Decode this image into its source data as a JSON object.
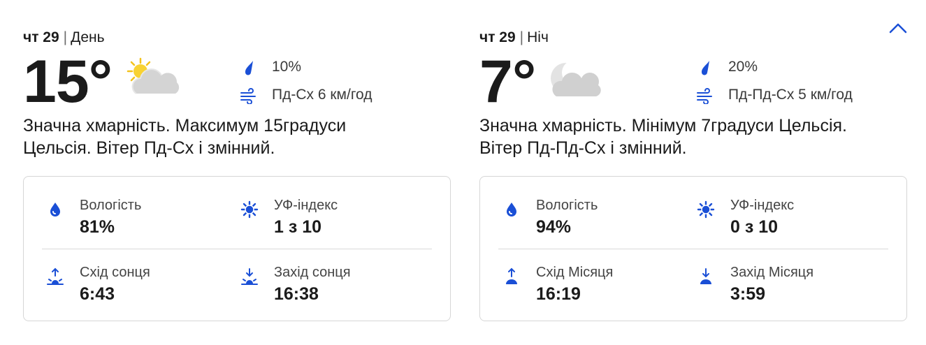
{
  "day": {
    "date": "чт 29",
    "period": "День",
    "temperature": "15°",
    "condition_icon": "sun-behind-cloud-icon",
    "precipitation": "10%",
    "wind": "Пд-Сх 6 км/год",
    "description": "Значна хмарність. Максимум 15градуси Цельсія. Вітер Пд-Сх і змінний.",
    "details": {
      "humidity_label": "Вологість",
      "humidity_value": "81%",
      "uv_label": "УФ-індекс",
      "uv_value": "1 з 10",
      "rise_label": "Схід сонця",
      "rise_value": "6:43",
      "set_label": "Захід сонця",
      "set_value": "16:38"
    }
  },
  "night": {
    "date": "чт 29",
    "period": "Ніч",
    "temperature": "7°",
    "condition_icon": "moon-behind-cloud-icon",
    "precipitation": "20%",
    "wind": "Пд-Пд-Сх 5 км/год",
    "description": "Значна хмарність. Мінімум 7градуси Цельсія. Вітер Пд-Пд-Сх і змінний.",
    "details": {
      "humidity_label": "Вологість",
      "humidity_value": "94%",
      "uv_label": "УФ-індекс",
      "uv_value": "0 з 10",
      "rise_label": "Схід Місяця",
      "rise_value": "16:19",
      "set_label": "Захід Місяця",
      "set_value": "3:59"
    }
  },
  "colors": {
    "accent_blue": "#1a4fd6",
    "text": "#1b1b1b",
    "card_border": "#d6d6d6"
  },
  "collapse_icon": "chevron-up-icon"
}
